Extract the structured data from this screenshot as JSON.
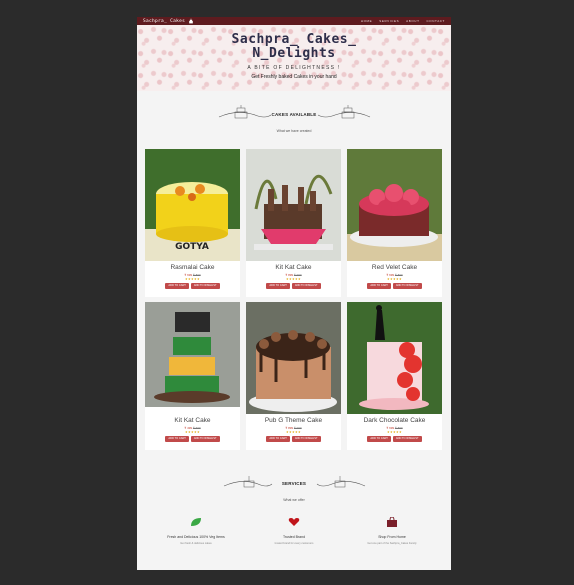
{
  "nav": {
    "brand": "Sachpra_ Cakes",
    "links": [
      "HOME",
      "SERVICES",
      "ABOUT",
      "CONTACT"
    ]
  },
  "hero": {
    "title_line1": "Sachpra_ Cakes_",
    "title_line2": "N_Delights",
    "tagline": "A BITE OF DELIGHTNESS !",
    "subtitle": "Get Freshly baked Cakes in your hand"
  },
  "cakes_section": {
    "title": "CAKES AVAILABLE",
    "subtitle": "What we have created"
  },
  "cakes": [
    {
      "name": "Rasmalai Cake",
      "price": "₹ 699",
      "old_price": "₹ 899",
      "rating": "★★★★★",
      "cart_label": "ADD TO CART",
      "wish_label": "ADD TO WISHLIST",
      "colors": [
        "#f2d21a",
        "#3f6e2c",
        "#f5ee9a"
      ]
    },
    {
      "name": "Kit Kat Cake",
      "price": "₹ 899",
      "old_price": "₹ 999",
      "rating": "★★★★★",
      "cart_label": "ADD TO CART",
      "wish_label": "ADD TO WISHLIST",
      "colors": [
        "#5a3a2a",
        "#e13b6c",
        "#eaeaea"
      ]
    },
    {
      "name": "Red Velet Cake",
      "price": "₹ 699",
      "old_price": "₹ 899",
      "rating": "★★★★★",
      "cart_label": "ADD TO CART",
      "wish_label": "ADD TO WISHLIST",
      "colors": [
        "#d6395a",
        "#7a2a2a",
        "#5f7a3a"
      ]
    },
    {
      "name": "Kit Kat Cake",
      "price": "₹ 499",
      "old_price": "₹ 699",
      "rating": "★★★★★",
      "cart_label": "ADD TO CART",
      "wish_label": "ADD TO WISHLIST",
      "colors": [
        "#2f8a3b",
        "#f0b73a",
        "#5a3b2a"
      ]
    },
    {
      "name": "Pub G Theme Cake",
      "price": "₹ 899",
      "old_price": "₹ 999",
      "rating": "★★★★★",
      "cart_label": "ADD TO CART",
      "wish_label": "ADD TO WISHLIST",
      "colors": [
        "#3b2418",
        "#c98f6a",
        "#eeeeee"
      ]
    },
    {
      "name": "Dark Chocolate Cake",
      "price": "₹ 699",
      "old_price": "₹ 899",
      "rating": "★★★★★",
      "cart_label": "ADD TO CART",
      "wish_label": "ADD TO WISHLIST",
      "colors": [
        "#e3342f",
        "#f7d9dd",
        "#3e6a2e"
      ]
    }
  ],
  "services_section": {
    "title": "SERVICES",
    "subtitle": "What we offer",
    "items": [
      {
        "icon": "leaf-icon",
        "title": "Fresh and Delicious 100% Veg Items",
        "desc": "Get fresh & delicious cakes",
        "color": "#3aa845"
      },
      {
        "icon": "heart-icon",
        "title": "Trusted Brand",
        "desc": "trusted brand for every customers",
        "color": "#c0141a"
      },
      {
        "icon": "bag-icon",
        "title": "Shop From Home",
        "desc": "Get one part of the Sachpra_Cakes Family",
        "color": "#7a1f2a"
      }
    ]
  }
}
